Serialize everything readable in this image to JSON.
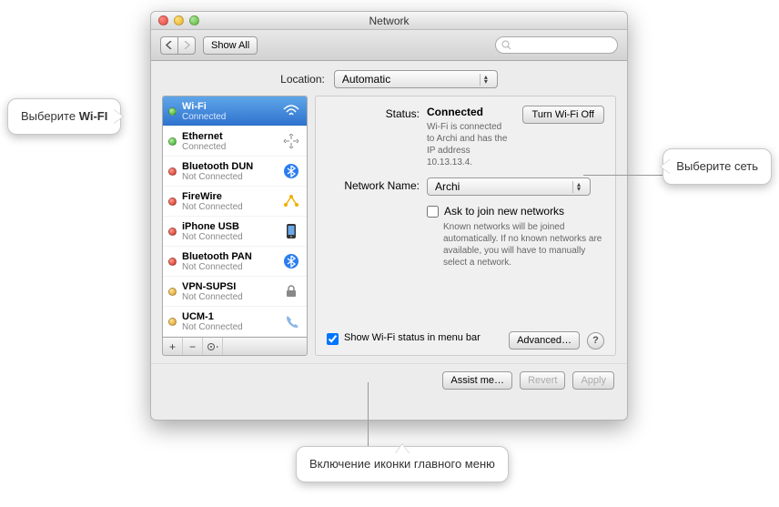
{
  "window": {
    "title": "Network"
  },
  "toolbar": {
    "show_all": "Show All"
  },
  "location": {
    "label": "Location:",
    "value": "Automatic"
  },
  "sidebar": {
    "items": [
      {
        "name": "Wi-Fi",
        "sub": "Connected",
        "status": "green"
      },
      {
        "name": "Ethernet",
        "sub": "Connected",
        "status": "green"
      },
      {
        "name": "Bluetooth DUN",
        "sub": "Not Connected",
        "status": "red"
      },
      {
        "name": "FireWire",
        "sub": "Not Connected",
        "status": "red"
      },
      {
        "name": "iPhone USB",
        "sub": "Not Connected",
        "status": "red"
      },
      {
        "name": "Bluetooth PAN",
        "sub": "Not Connected",
        "status": "red"
      },
      {
        "name": "VPN-SUPSI",
        "sub": "Not Connected",
        "status": "amber"
      },
      {
        "name": "UCM-1",
        "sub": "Not Connected",
        "status": "amber"
      }
    ]
  },
  "panel": {
    "status_label": "Status:",
    "status_value": "Connected",
    "turn_off": "Turn Wi-Fi Off",
    "status_desc": "Wi-Fi is connected to Archi and has the IP address 10.13.13.4.",
    "netname_label": "Network Name:",
    "netname_value": "Archi",
    "ask_label": "Ask to join new networks",
    "ask_desc": "Known networks will be joined automatically. If no known networks are available, you will have to manually select a network.",
    "show_status": "Show Wi-Fi status in menu bar",
    "advanced": "Advanced…"
  },
  "footer": {
    "assist": "Assist me…",
    "revert": "Revert",
    "apply": "Apply"
  },
  "callouts": {
    "left_pre": "Выберите ",
    "left_bold": "Wi-FI",
    "right": "Выберите сеть",
    "bottom": "Включение иконки главного меню"
  }
}
